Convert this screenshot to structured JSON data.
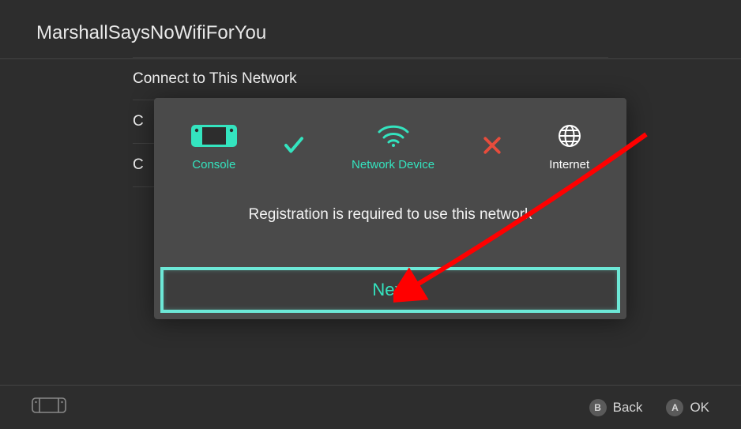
{
  "header": {
    "title": "MarshallSaysNoWifiForYou"
  },
  "list": {
    "row1": "Connect to This Network",
    "row2_prefix": "C",
    "row3_prefix": "C"
  },
  "dialog": {
    "console_label": "Console",
    "network_label": "Network Device",
    "internet_label": "Internet",
    "message": "Registration is required to use this network",
    "next_label": "Next"
  },
  "footer": {
    "back_label": "Back",
    "back_glyph": "B",
    "ok_label": "OK",
    "ok_glyph": "A"
  },
  "colors": {
    "accent": "#34e4bf",
    "error": "#e74c3c",
    "background": "#2d2d2d",
    "dialog_bg": "#4a4a4a"
  }
}
